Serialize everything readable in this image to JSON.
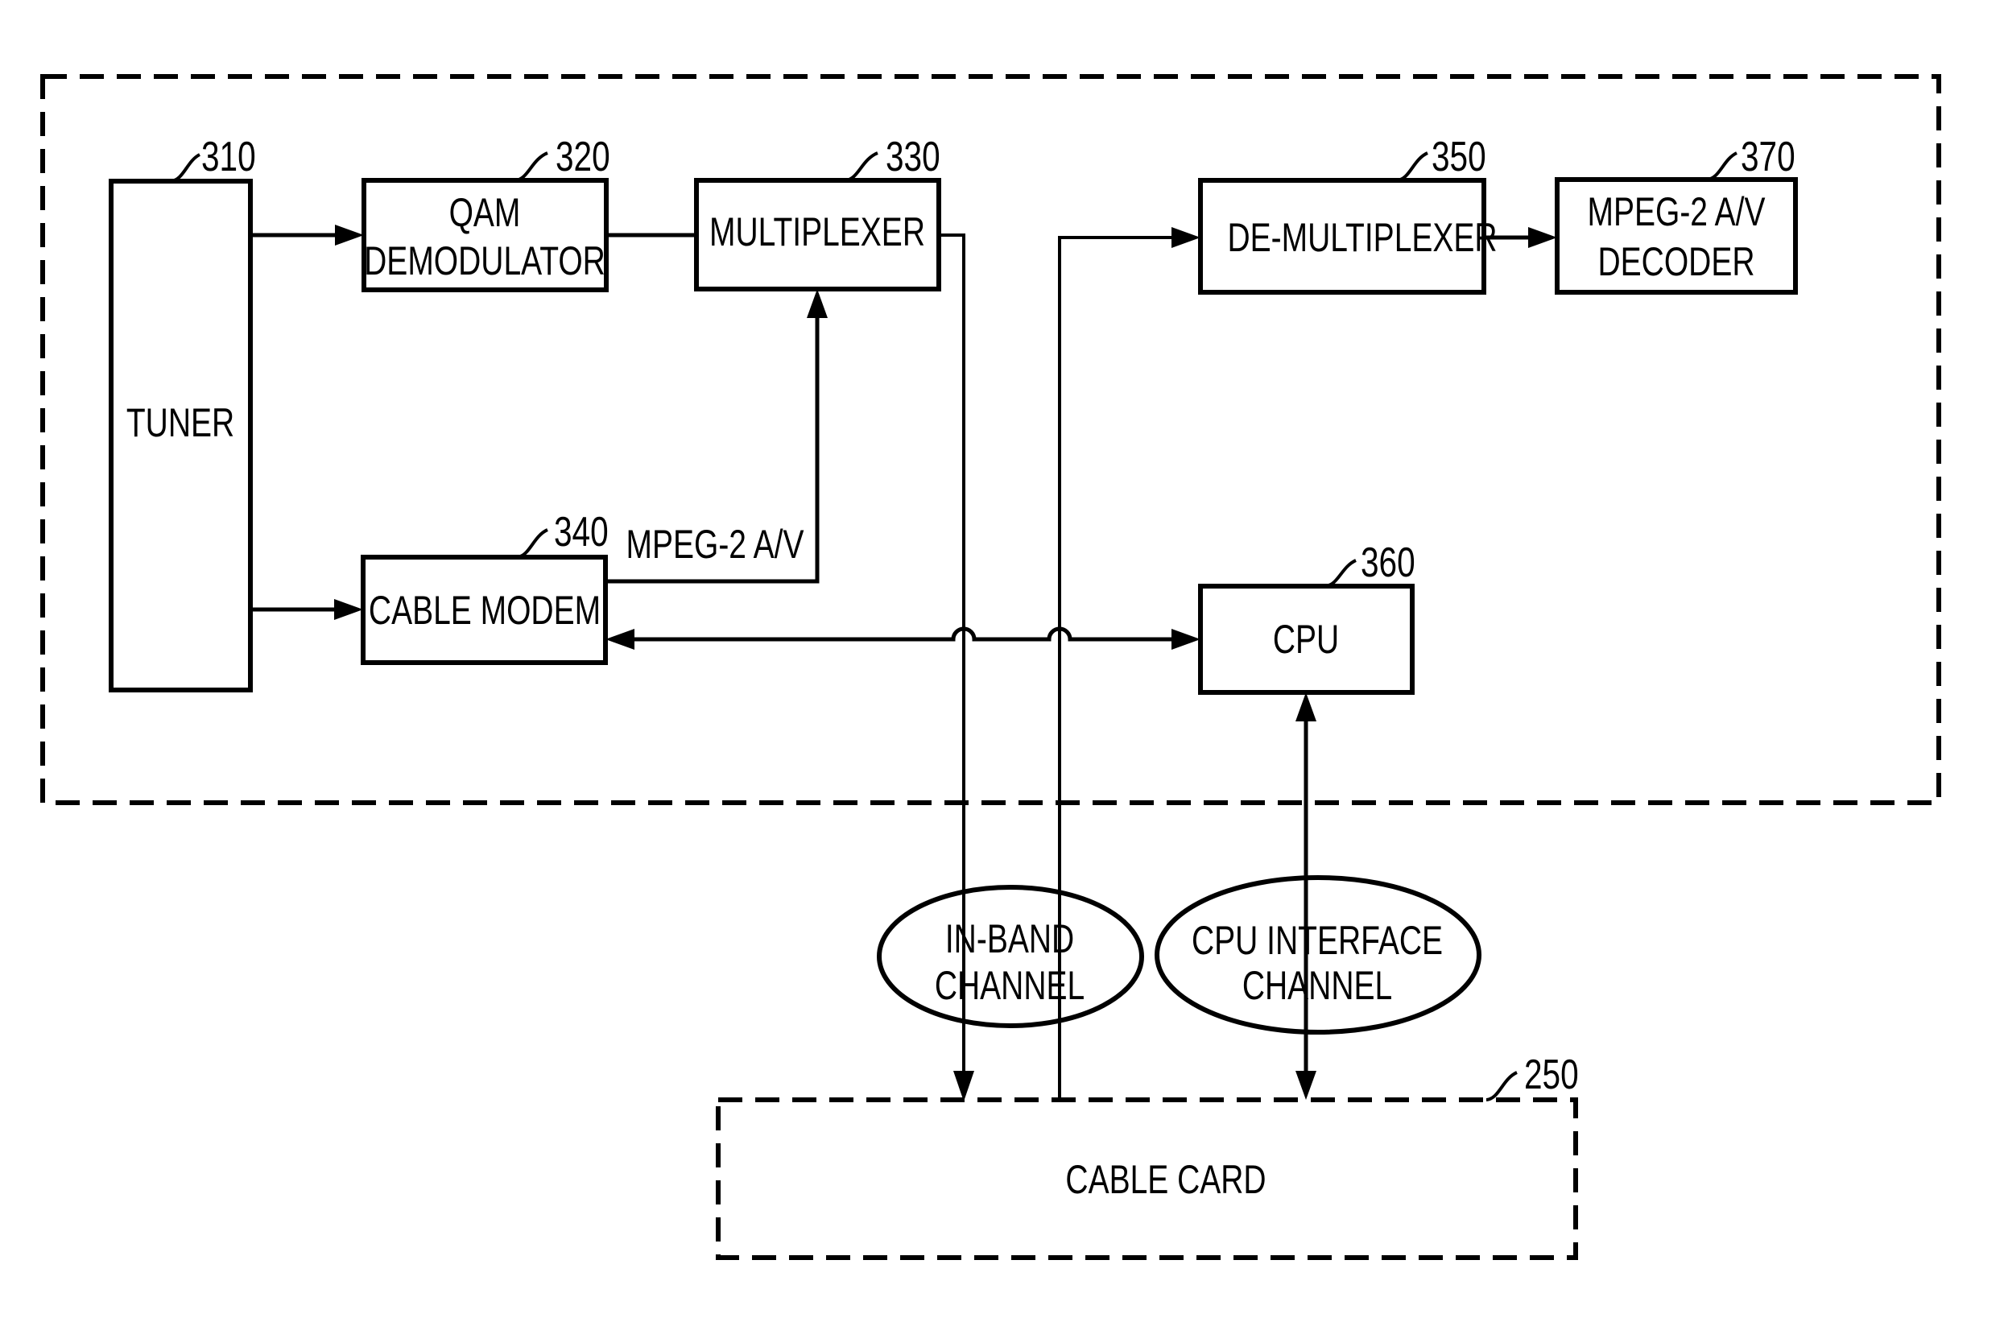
{
  "figure": {
    "type": "block-diagram",
    "colors": {
      "ink": "#000000",
      "background": "#ffffff"
    }
  },
  "host_device": {
    "style": "dashed-boundary"
  },
  "blocks": {
    "tuner": {
      "ref": "310",
      "lines": [
        "TUNER"
      ]
    },
    "qam": {
      "ref": "320",
      "lines": [
        "QAM",
        "DEMODULATOR"
      ]
    },
    "mux": {
      "ref": "330",
      "lines": [
        "MULTIPLEXER"
      ]
    },
    "modem": {
      "ref": "340",
      "lines": [
        "CABLE MODEM"
      ]
    },
    "demux": {
      "ref": "350",
      "lines": [
        "DE-MULTIPLEXER"
      ]
    },
    "cpu": {
      "ref": "360",
      "lines": [
        "CPU"
      ]
    },
    "decoder": {
      "ref": "370",
      "lines": [
        "MPEG-2 A/V",
        "DECODER"
      ]
    },
    "cablecard": {
      "ref": "250",
      "lines": [
        "CABLE CARD"
      ]
    }
  },
  "signals": {
    "modem_to_mux": "MPEG-2 A/V"
  },
  "channels": {
    "inband": {
      "lines": [
        "IN-BAND",
        "CHANNEL"
      ]
    },
    "cpu_interface": {
      "lines": [
        "CPU INTERFACE",
        "CHANNEL"
      ]
    }
  },
  "connections": [
    {
      "from": "TUNER",
      "to": "QAM DEMODULATOR",
      "arrow": "forward"
    },
    {
      "from": "TUNER",
      "to": "CABLE MODEM",
      "arrow": "forward"
    },
    {
      "from": "QAM DEMODULATOR",
      "to": "MULTIPLEXER",
      "arrow": "none"
    },
    {
      "from": "CABLE MODEM",
      "to": "MULTIPLEXER",
      "label": "MPEG-2 A/V",
      "arrow": "forward"
    },
    {
      "from": "MULTIPLEXER",
      "to": "CABLE CARD",
      "via": "IN-BAND CHANNEL",
      "arrow": "forward"
    },
    {
      "from": "CABLE CARD",
      "to": "DE-MULTIPLEXER",
      "via": "IN-BAND CHANNEL",
      "arrow": "forward"
    },
    {
      "from": "DE-MULTIPLEXER",
      "to": "MPEG-2 A/V DECODER",
      "arrow": "forward"
    },
    {
      "from": "CABLE MODEM",
      "to": "CPU",
      "arrow": "bidirectional"
    },
    {
      "from": "CPU",
      "to": "CABLE CARD",
      "via": "CPU INTERFACE CHANNEL",
      "arrow": "bidirectional"
    }
  ]
}
